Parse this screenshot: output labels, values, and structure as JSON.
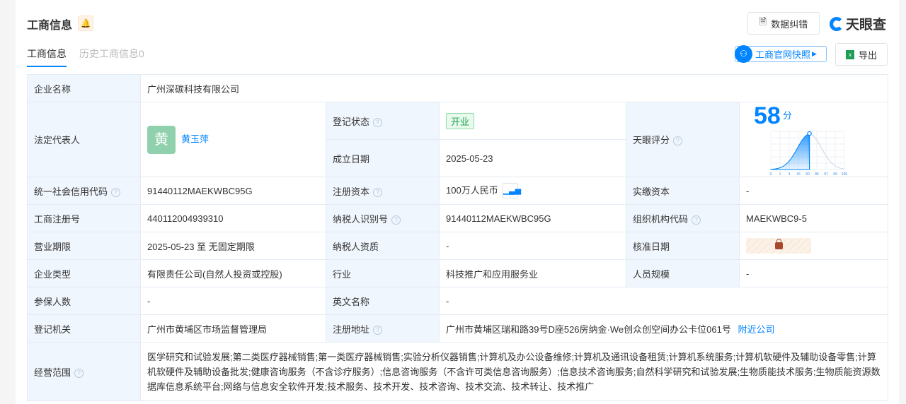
{
  "header": {
    "title": "工商信息",
    "bell_icon": "bell-icon",
    "correct_label": "数据纠错",
    "brand": "天眼查",
    "snapshot_label": "工商官网快照",
    "export_label": "导出"
  },
  "tabs": [
    {
      "label": "工商信息",
      "active": true
    },
    {
      "label": "历史工商信息0",
      "active": false
    }
  ],
  "info": {
    "company_name_label": "企业名称",
    "company_name": "广州深碳科技有限公司",
    "legal_rep_label": "法定代表人",
    "legal_rep_avatar": "黄",
    "legal_rep": "黄玉萍",
    "reg_status_label": "登记状态",
    "reg_status": "开业",
    "found_date_label": "成立日期",
    "found_date": "2025-05-23",
    "score_label": "天眼评分",
    "score": "58",
    "score_unit": "分",
    "credit_code_label": "统一社会信用代码",
    "credit_code": "91440112MAEKWBC95G",
    "reg_capital_label": "注册资本",
    "reg_capital": "100万人民币",
    "paid_capital_label": "实缴资本",
    "paid_capital": "-",
    "reg_no_label": "工商注册号",
    "reg_no": "440112004939310",
    "taxpayer_id_label": "纳税人识别号",
    "taxpayer_id": "91440112MAEKWBC95G",
    "org_code_label": "组织机构代码",
    "org_code": "MAEKWBC9-5",
    "term_label": "营业期限",
    "term": "2025-05-23 至 无固定期限",
    "taxpayer_qual_label": "纳税人资质",
    "taxpayer_qual": "-",
    "approve_date_label": "核准日期",
    "type_label": "企业类型",
    "type": "有限责任公司(自然人投资或控股)",
    "industry_label": "行业",
    "industry": "科技推广和应用服务业",
    "staff_label": "人员规模",
    "staff": "-",
    "insured_label": "参保人数",
    "insured": "-",
    "en_name_label": "英文名称",
    "en_name": "-",
    "authority_label": "登记机关",
    "authority": "广州市黄埔区市场监督管理局",
    "address_label": "注册地址",
    "address": "广州市黄埔区瑞和路39号D座526房纳金·We创众创空间办公卡位061号",
    "nearby_label": "附近公司",
    "scope_label": "经营范围",
    "scope": "医学研究和试验发展;第二类医疗器械销售;第一类医疗器械销售;实验分析仪器销售;计算机及办公设备维修;计算机及通讯设备租赁;计算机系统服务;计算机软硬件及辅助设备零售;计算机软硬件及辅助设备批发;健康咨询服务（不含诊疗服务）;信息咨询服务（不含许可类信息咨询服务）;信息技术咨询服务;自然科学研究和试验发展;生物质能技术服务;生物质能资源数据库信息系统平台;网络与信息安全软件开发;技术服务、技术开发、技术咨询、技术交流、技术转让、技术推广"
  },
  "chart_data": {
    "type": "area",
    "title": "",
    "x_ticks": [
      "0",
      "1",
      "3",
      "15",
      "50",
      "85",
      "97",
      "99",
      "100"
    ],
    "marker_value": 58,
    "ylim": [
      0,
      1
    ],
    "colors": {
      "fill": "#0084ff",
      "line": "#0084ff",
      "rest": "#c9d6e6"
    }
  }
}
